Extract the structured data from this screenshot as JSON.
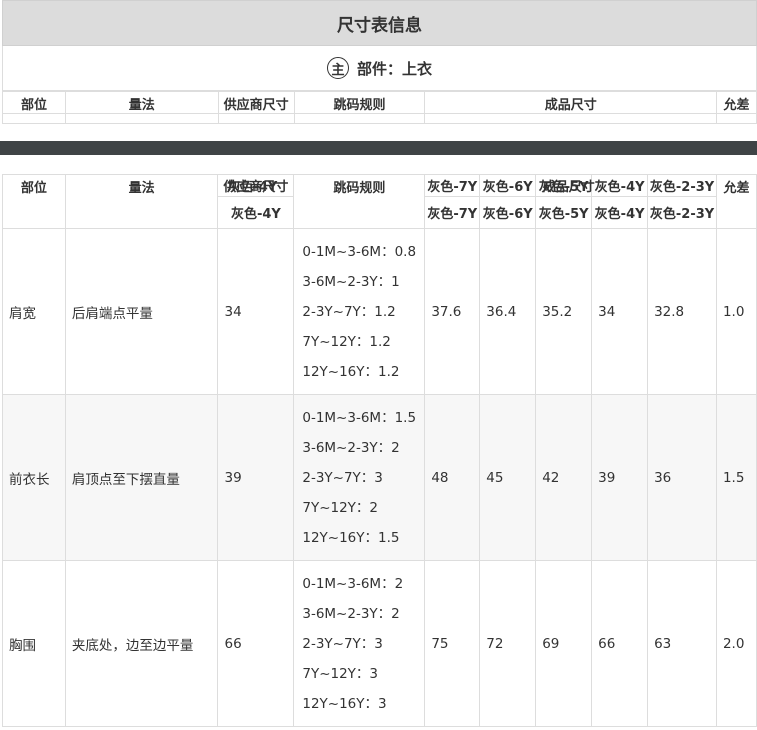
{
  "header": {
    "title": "尺寸表信息"
  },
  "section": {
    "badge": "主",
    "label": "部件：上衣"
  },
  "summary_table": {
    "headers": [
      "部位",
      "量法",
      "供应商尺寸",
      "跳码规则",
      "成品尺寸",
      "允差"
    ]
  },
  "detail_table": {
    "headers": {
      "part": "部位",
      "method": "量法",
      "supplier": "供应商尺寸",
      "supplier_overlap": "灰色-4Y",
      "rules": "跳码规则",
      "finished": "成品尺寸",
      "tolerance": "允差"
    },
    "supplier_size": "灰色-4Y",
    "size_columns": [
      "灰色-7Y",
      "灰色-6Y",
      "灰色-5Y",
      "灰色-4Y",
      "灰色-2-3Y"
    ],
    "rows": [
      {
        "part": "肩宽",
        "method": "后肩端点平量",
        "supplier": "34",
        "rules": [
          "0-1M~3-6M：0.8",
          "3-6M~2-3Y：1",
          "2-3Y~7Y：1.2",
          "7Y~12Y：1.2",
          "12Y~16Y：1.2"
        ],
        "sizes": [
          "37.6",
          "36.4",
          "35.2",
          "34",
          "32.8"
        ],
        "tolerance": "1.0"
      },
      {
        "part": "前衣长",
        "method": "肩顶点至下摆直量",
        "supplier": "39",
        "rules": [
          "0-1M~3-6M：1.5",
          "3-6M~2-3Y：2",
          "2-3Y~7Y：3",
          "7Y~12Y：2",
          "12Y~16Y：1.5"
        ],
        "sizes": [
          "48",
          "45",
          "42",
          "39",
          "36"
        ],
        "tolerance": "1.5"
      },
      {
        "part": "胸围",
        "method": "夹底处，边至边平量",
        "supplier": "66",
        "rules": [
          "0-1M~3-6M：2",
          "3-6M~2-3Y：2",
          "2-3Y~7Y：3",
          "7Y~12Y：3",
          "12Y~16Y：3"
        ],
        "sizes": [
          "75",
          "72",
          "69",
          "66",
          "63"
        ],
        "tolerance": "2.0"
      }
    ]
  }
}
